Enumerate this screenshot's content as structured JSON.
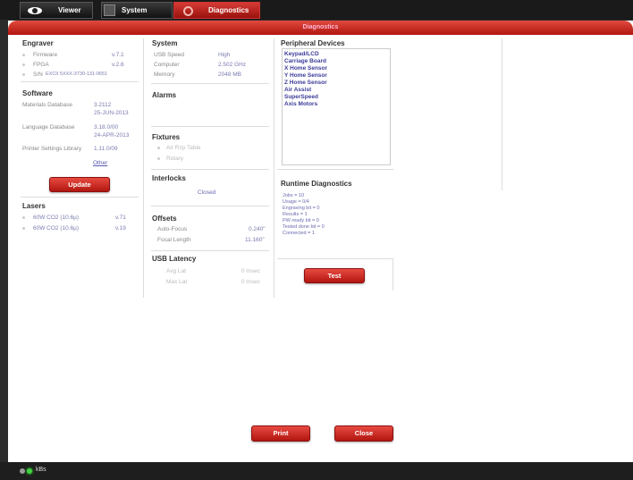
{
  "tabs": [
    {
      "label": "Viewer"
    },
    {
      "label": "System"
    },
    {
      "label": "Diagnostics"
    }
  ],
  "window_title": "Diagnostics",
  "engraver": {
    "title": "Engraver",
    "rows": [
      {
        "key": "Firmware",
        "value": "v.7.1"
      },
      {
        "key": "FPGA",
        "value": "v.2.6"
      },
      {
        "key": "S/N",
        "value": "EXCII 5XXX-3730-131-0651"
      }
    ]
  },
  "software": {
    "title": "Software",
    "rows": [
      {
        "key": "Materials Database",
        "value": "3.2112",
        "value2": "25-JUN-2013"
      },
      {
        "key": "Language Database",
        "value": "3.18.0/00",
        "value2": "24-APR-2013"
      },
      {
        "key": "Printer Settings Library",
        "value": "1.11.0/09"
      }
    ],
    "other_link": "Other",
    "update_button": "Update"
  },
  "lasers": {
    "title": "Lasers",
    "rows": [
      {
        "key": "60W CO2 (10.6µ)",
        "value": "v.71"
      },
      {
        "key": "60W CO2 (10.6µ)",
        "value": "v.19"
      }
    ]
  },
  "system": {
    "title": "System",
    "rows": [
      {
        "key": "USB Speed",
        "value": "High"
      },
      {
        "key": "Computer",
        "value": "2.502 GHz"
      },
      {
        "key": "Memory",
        "value": "2048 MB"
      }
    ]
  },
  "alarms": {
    "title": "Alarms"
  },
  "fixtures": {
    "title": "Fixtures",
    "rows": [
      {
        "key": "Air Rzp Table"
      },
      {
        "key": "Rotary"
      }
    ]
  },
  "interlocks": {
    "title": "Interlocks",
    "status": "Closed"
  },
  "offsets": {
    "title": "Offsets",
    "rows": [
      {
        "key": "Auto-Focus",
        "value": "0.240\""
      },
      {
        "key": "Focal Length",
        "value": "11.160\""
      }
    ]
  },
  "usb_latency": {
    "title": "USB Latency",
    "rows": [
      {
        "key": "Avg Lat",
        "value": "0 msec"
      },
      {
        "key": "Max Lat",
        "value": "0 msec"
      }
    ]
  },
  "peripheral": {
    "title": "Peripheral Devices",
    "items": [
      "Keypad/LCD",
      "Carriage Board",
      "X Home Sensor",
      "Y Home Sensor",
      "Z Home Sensor",
      "Air Assist",
      "SuperSpeed",
      "Axis Motors"
    ]
  },
  "runtime": {
    "title": "Runtime Diagnostics",
    "lines": [
      "Jobs = 10",
      "Usage = 0/4",
      "Engraving bit = 0",
      "Results = 1",
      "PW ready bit = 0",
      "Tested done bit = 0",
      "Connected = 1"
    ],
    "test_button": "Test"
  },
  "footer": {
    "print_button": "Print",
    "close_button": "Close"
  },
  "status": {
    "label": "kBs"
  }
}
